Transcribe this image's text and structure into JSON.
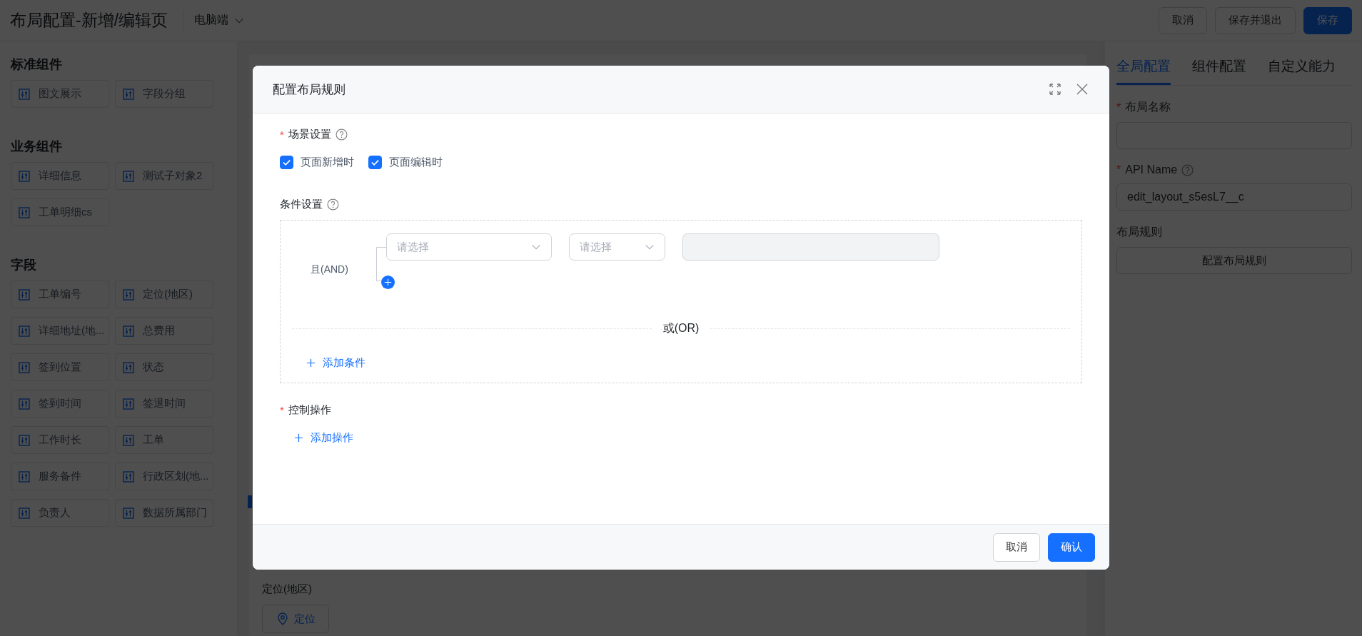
{
  "header": {
    "title": "布局配置-新增/编辑页",
    "device": "电脑端",
    "buttons": [
      {
        "label": "取消",
        "kind": "default"
      },
      {
        "label": "保存并退出",
        "kind": "default"
      },
      {
        "label": "保存",
        "kind": "primary"
      }
    ]
  },
  "sidebar": {
    "groups": [
      {
        "title": "标准组件",
        "items": [
          "图文展示",
          "字段分组"
        ]
      },
      {
        "title": "业务组件",
        "items": [
          "详细信息",
          "测试子对象2",
          "工单明细cs"
        ]
      },
      {
        "title": "字段",
        "items": [
          "工单编号",
          "定位(地区)",
          "详细地址(地...",
          "总费用",
          "签到位置",
          "状态",
          "签到时间",
          "签退时间",
          "工作时长",
          "工单",
          "服务备件",
          "行政区划(地...",
          "负责人",
          "数据所属部门"
        ]
      }
    ]
  },
  "canvas": {
    "field_label": "定位(地区)",
    "field_button": "定位"
  },
  "right_panel": {
    "tabs": [
      {
        "label": "全局配置",
        "selected": true
      },
      {
        "label": "组件配置",
        "selected": false
      },
      {
        "label": "自定义能力",
        "selected": false
      }
    ],
    "fields": [
      {
        "label": "布局名称",
        "required_mark": "*"
      },
      {
        "label": "API Name",
        "required_mark": "*",
        "help": true,
        "value": "edit_layout_s5esL7__c"
      }
    ],
    "rule": {
      "label": "布局规则",
      "button": "配置布局规则"
    }
  },
  "modal": {
    "title": "配置布局规则",
    "scene": {
      "label": "场景设置",
      "required_mark": "*",
      "help": true,
      "options": [
        {
          "label": "页面新增时",
          "checked": true
        },
        {
          "label": "页面编辑时",
          "checked": true
        }
      ]
    },
    "conditions": {
      "label": "条件设置",
      "help": true,
      "group_label": "且(AND)",
      "selects": [
        {
          "placeholder": "请选择",
          "kind": "wide"
        },
        {
          "placeholder": "请选择",
          "kind": "narrow"
        }
      ],
      "value_field": {
        "disabled": true
      },
      "or_label": "或(OR)",
      "add": "添加条件"
    },
    "actions": {
      "label": "控制操作",
      "required_mark": "*",
      "add": "添加操作"
    },
    "buttons": [
      {
        "label": "取消",
        "kind": "default"
      },
      {
        "label": "确认",
        "kind": "primary"
      }
    ]
  }
}
